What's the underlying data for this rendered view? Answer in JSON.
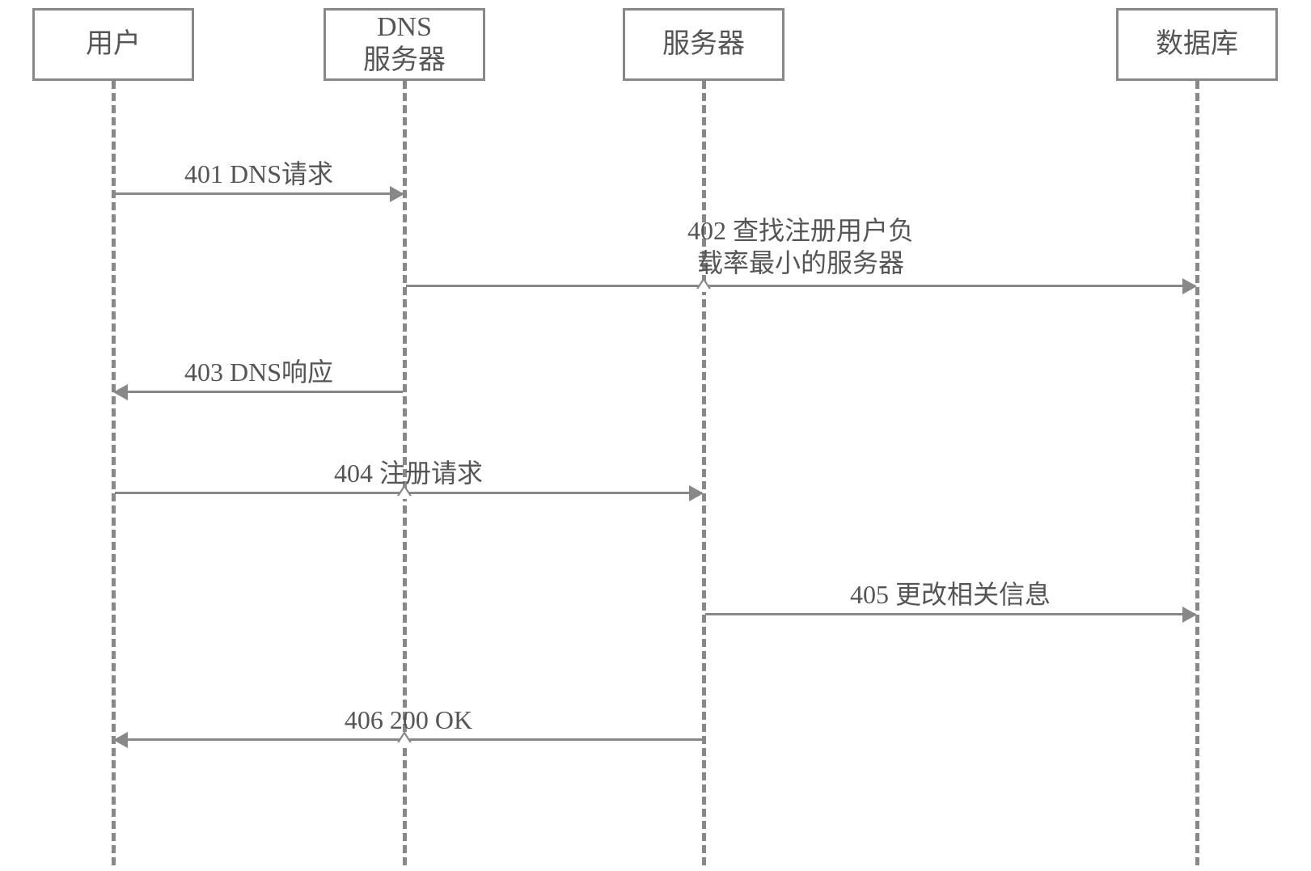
{
  "participants": {
    "user": "用户",
    "dns": "DNS\n服务器",
    "server": "服务器",
    "database": "数据库"
  },
  "messages": {
    "m401": "401  DNS请求",
    "m402": "402  查找注册用户负\n载率最小的服务器",
    "m403": "403  DNS响应",
    "m404": "404  注册请求",
    "m405": "405  更改相关信息",
    "m406": "406  200 OK"
  },
  "chart_data": {
    "type": "sequence-diagram",
    "participants": [
      "用户",
      "DNS 服务器",
      "服务器",
      "数据库"
    ],
    "messages": [
      {
        "id": "401",
        "from": "用户",
        "to": "DNS 服务器",
        "label": "DNS请求"
      },
      {
        "id": "402",
        "from": "DNS 服务器",
        "to": "数据库",
        "label": "查找注册用户负载率最小的服务器",
        "passes_through": [
          "服务器"
        ]
      },
      {
        "id": "403",
        "from": "DNS 服务器",
        "to": "用户",
        "label": "DNS响应"
      },
      {
        "id": "404",
        "from": "用户",
        "to": "服务器",
        "label": "注册请求",
        "passes_through": [
          "DNS 服务器"
        ]
      },
      {
        "id": "405",
        "from": "服务器",
        "to": "数据库",
        "label": "更改相关信息"
      },
      {
        "id": "406",
        "from": "服务器",
        "to": "用户",
        "label": "200 OK",
        "passes_through": [
          "DNS 服务器"
        ]
      }
    ]
  }
}
